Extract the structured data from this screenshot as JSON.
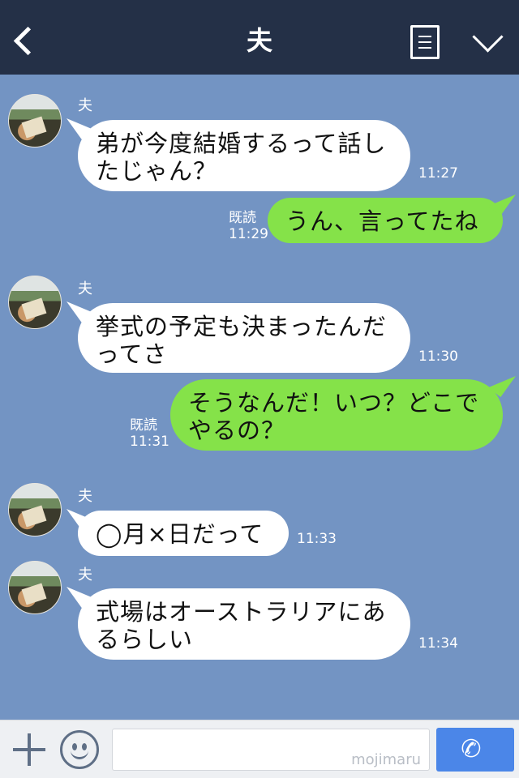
{
  "header": {
    "title": "夫"
  },
  "messages": [
    {
      "type": "incoming",
      "sender": "夫",
      "lines": [
        "弟が今度結婚するって話し",
        "たじゃん？"
      ],
      "time": "11:27"
    },
    {
      "type": "outgoing",
      "read": "既読",
      "time": "11:29",
      "lines": [
        "うん、言ってたね"
      ]
    },
    {
      "type": "incoming",
      "sender": "夫",
      "lines": [
        "挙式の予定も決まったんだ",
        "ってさ"
      ],
      "time": "11:30"
    },
    {
      "type": "outgoing",
      "read": "既読",
      "time": "11:31",
      "lines": [
        "そうなんだ！いつ？どこで",
        "やるの？"
      ]
    },
    {
      "type": "incoming",
      "sender": "夫",
      "lines": [
        "◯月×日だって"
      ],
      "time": "11:33"
    },
    {
      "type": "incoming",
      "sender": "夫",
      "lines": [
        "式場はオーストラリアにあ",
        "るらしい"
      ],
      "time": "11:34"
    }
  ],
  "footer": {
    "watermark": "mojimaru",
    "call_icon": "✆"
  },
  "colors": {
    "header_bg": "#243047",
    "chat_bg": "#7394c3",
    "incoming_bubble": "#ffffff",
    "outgoing_bubble": "#85e249",
    "call_button": "#4b86e8"
  },
  "icons": [
    "back-arrow-icon",
    "menu-icon",
    "chevron-down-icon",
    "plus-icon",
    "emoji-icon",
    "phone-icon"
  ]
}
